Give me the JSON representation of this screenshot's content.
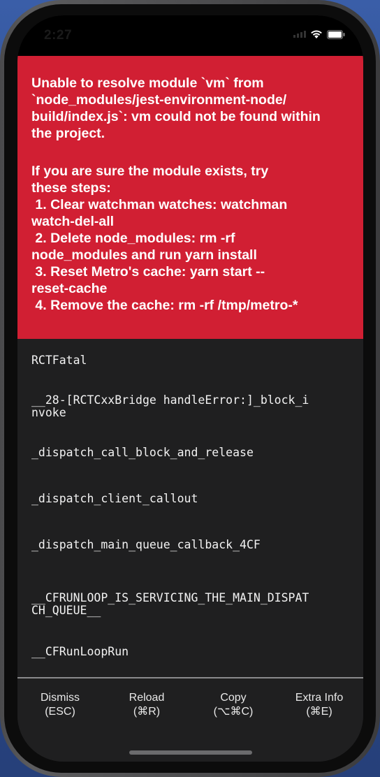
{
  "status_bar": {
    "time": "2:27"
  },
  "error": {
    "title": "Unable to resolve module `vm` from\n`node_modules/jest-environment-node/\nbuild/index.js`: vm could not be found within\nthe project.",
    "help": "If you are sure the module exists, try\nthese steps:\n 1. Clear watchman watches: watchman\nwatch-del-all\n 2. Delete node_modules: rm -rf\nnode_modules and run yarn install\n 3. Reset Metro's cache: yarn start --\nreset-cache\n 4. Remove the cache: rm -rf /tmp/metro-*"
  },
  "stack": [
    "RCTFatal",
    "__28-[RCTCxxBridge handleError:]_block_i\nnvoke",
    "_dispatch_call_block_and_release",
    "_dispatch_client_callout",
    "_dispatch_main_queue_callback_4CF",
    "__CFRUNLOOP_IS_SERVICING_THE_MAIN_DISPAT\nCH_QUEUE__",
    "__CFRunLoopRun"
  ],
  "actions": {
    "dismiss": {
      "label": "Dismiss",
      "shortcut": "(ESC)"
    },
    "reload": {
      "label": "Reload",
      "shortcut": "(⌘R)"
    },
    "copy": {
      "label": "Copy",
      "shortcut": "(⌥⌘C)"
    },
    "extra_info": {
      "label": "Extra Info",
      "shortcut": "(⌘E)"
    }
  },
  "colors": {
    "error_red": "#d11f33",
    "background": "#1f1f20"
  }
}
